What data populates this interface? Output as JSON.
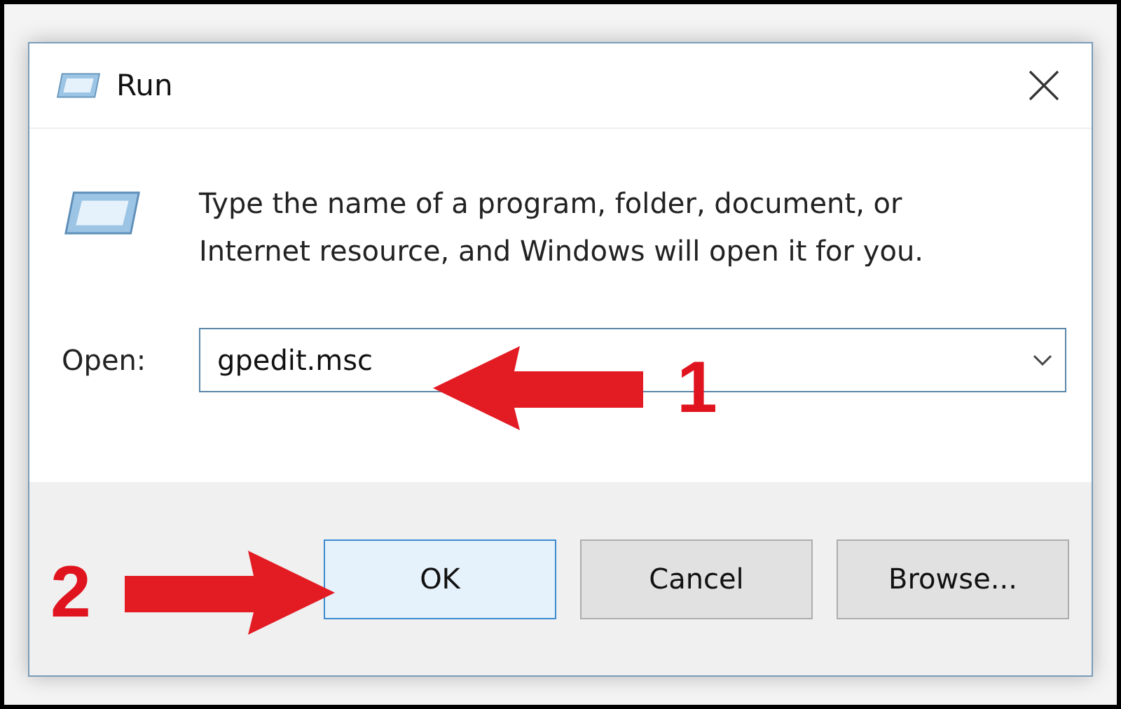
{
  "window": {
    "title": "Run"
  },
  "message": "Type the name of a program, folder, document, or Internet resource, and Windows will open it for you.",
  "open_field": {
    "label": "Open:",
    "value": "gpedit.msc"
  },
  "buttons": [
    {
      "label": "OK",
      "selected": true
    },
    {
      "label": "Cancel",
      "selected": false
    },
    {
      "label": "Browse...",
      "selected": false
    }
  ],
  "annotations": [
    {
      "label": "1",
      "kind": "left"
    },
    {
      "label": "2",
      "kind": "right"
    }
  ]
}
